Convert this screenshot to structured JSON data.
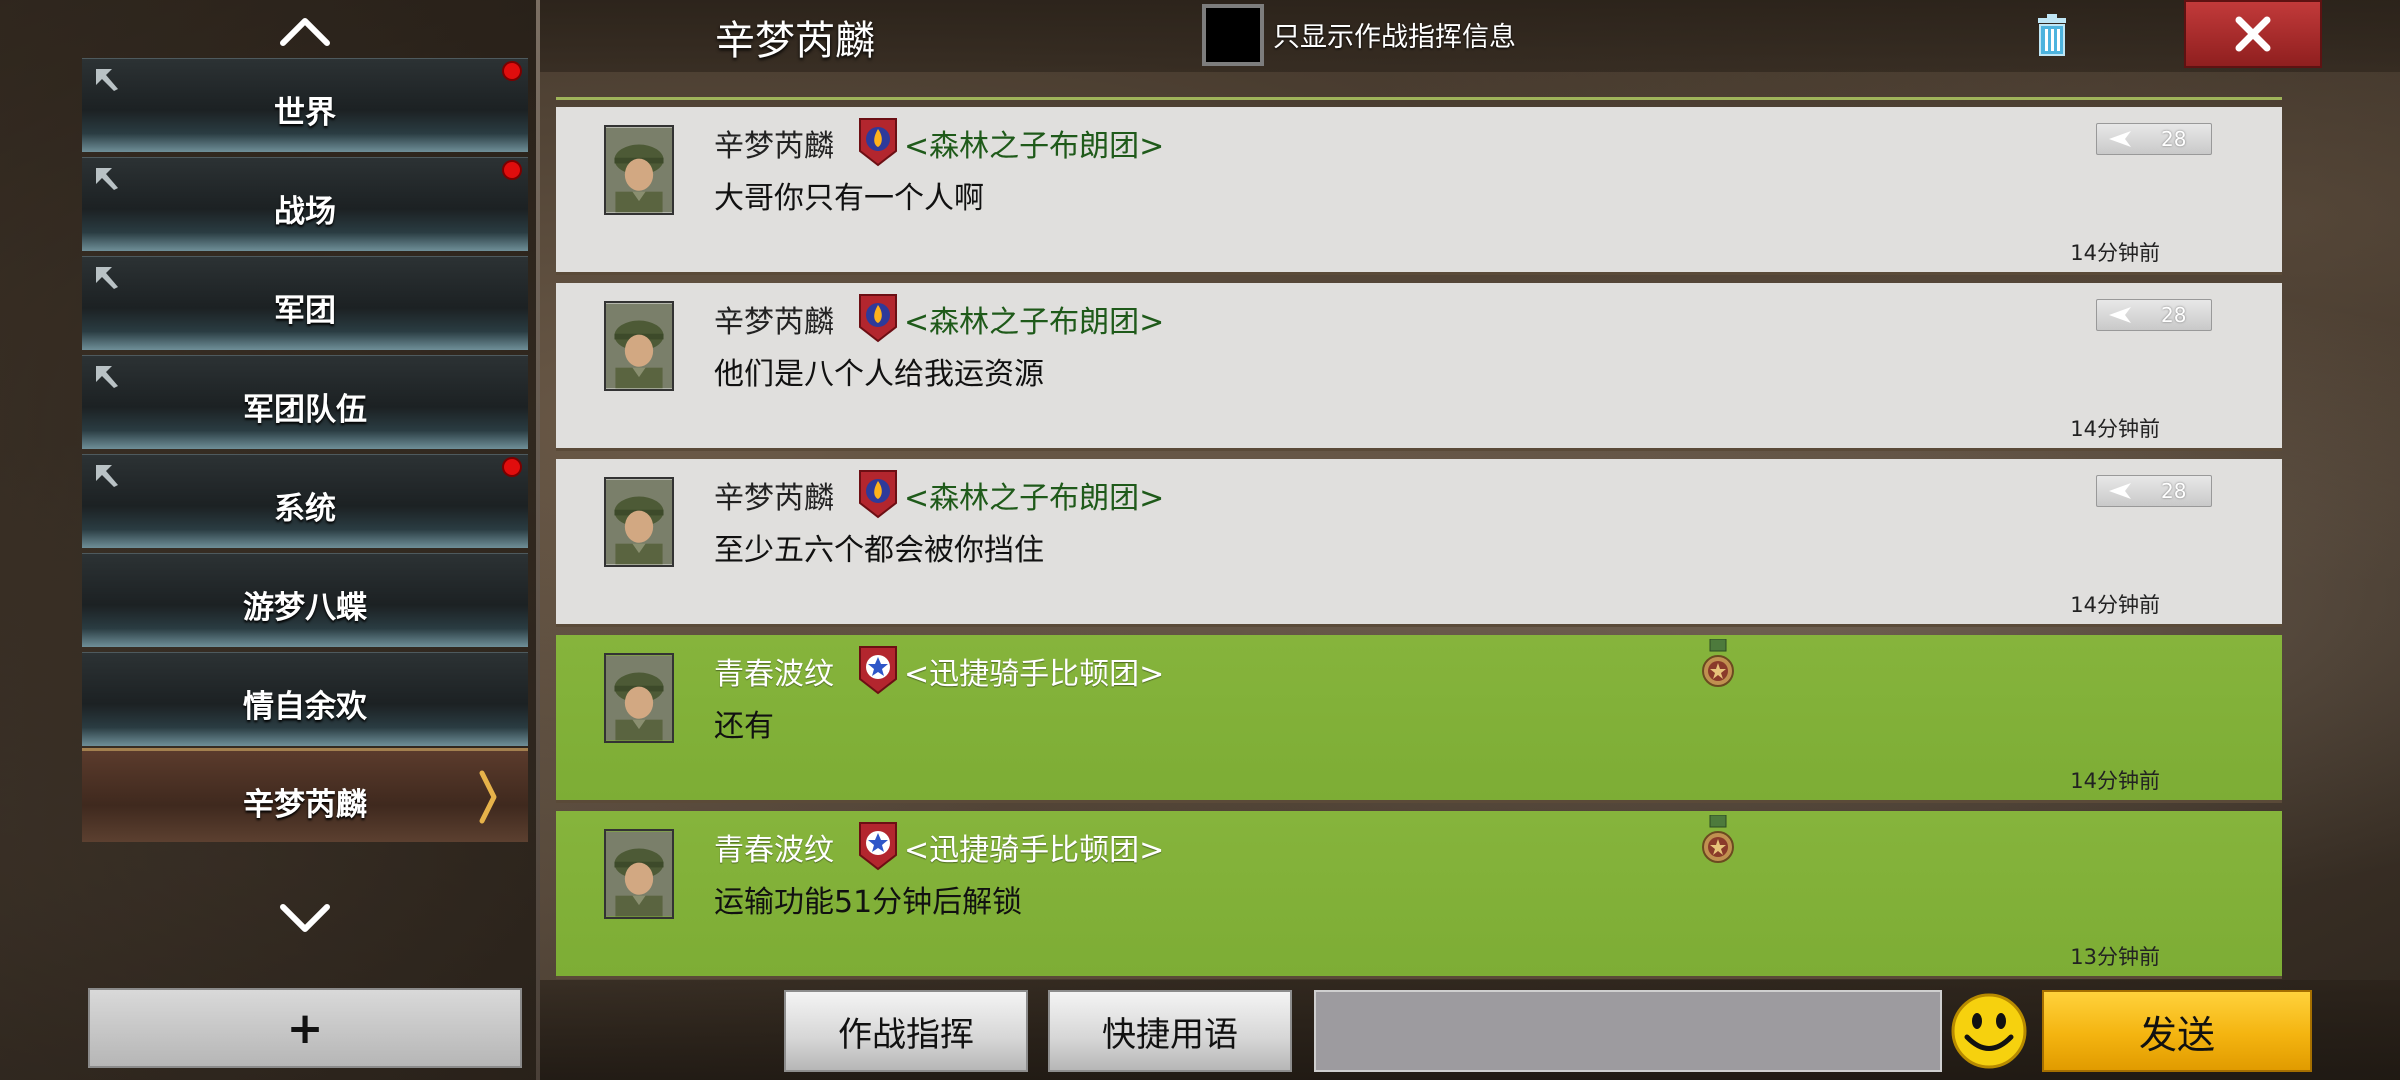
{
  "sidebar": {
    "channels": [
      {
        "label": "世界",
        "pinned": true,
        "unread": true,
        "active": false
      },
      {
        "label": "战场",
        "pinned": true,
        "unread": true,
        "active": false
      },
      {
        "label": "军团",
        "pinned": true,
        "unread": false,
        "active": false
      },
      {
        "label": "军团队伍",
        "pinned": true,
        "unread": false,
        "active": false
      },
      {
        "label": "系统",
        "pinned": true,
        "unread": true,
        "active": false
      },
      {
        "label": "游梦八蝶",
        "pinned": false,
        "unread": false,
        "active": false
      },
      {
        "label": "情自余欢",
        "pinned": false,
        "unread": false,
        "active": false
      },
      {
        "label": "辛梦芮麟",
        "pinned": false,
        "unread": false,
        "active": true
      }
    ],
    "add_label": "+"
  },
  "header": {
    "title": "辛梦芮麟",
    "filter_label": "只显示作战指挥信息"
  },
  "messages": [
    {
      "sender": "辛梦芮麟",
      "legion": "<森林之子布朗团>",
      "text": "大哥你只有一个人啊",
      "time": "14分钟前",
      "likes": "28",
      "ally": false
    },
    {
      "sender": "辛梦芮麟",
      "legion": "<森林之子布朗团>",
      "text": "他们是八个人给我运资源",
      "time": "14分钟前",
      "likes": "28",
      "ally": false
    },
    {
      "sender": "辛梦芮麟",
      "legion": "<森林之子布朗团>",
      "text": "至少五六个都会被你挡住",
      "time": "14分钟前",
      "likes": "28",
      "ally": false
    },
    {
      "sender": "青春波纹",
      "legion": "<迅捷骑手比顿团>",
      "text": "还有",
      "time": "14分钟前",
      "likes": "",
      "ally": true
    },
    {
      "sender": "青春波纹",
      "legion": "<迅捷骑手比顿团>",
      "text": "运输功能51分钟后解锁",
      "time": "13分钟前",
      "likes": "",
      "ally": true
    }
  ],
  "bottom": {
    "command_label": "作战指挥",
    "quick_label": "快捷用语",
    "input_value": "",
    "send_label": "发送"
  },
  "colors": {
    "ally_row": "#86b43c",
    "own_row": "#e0dfdd",
    "send_button": "#f4b410",
    "close_button": "#c23a3a",
    "unread_dot": "#e00d0d"
  }
}
